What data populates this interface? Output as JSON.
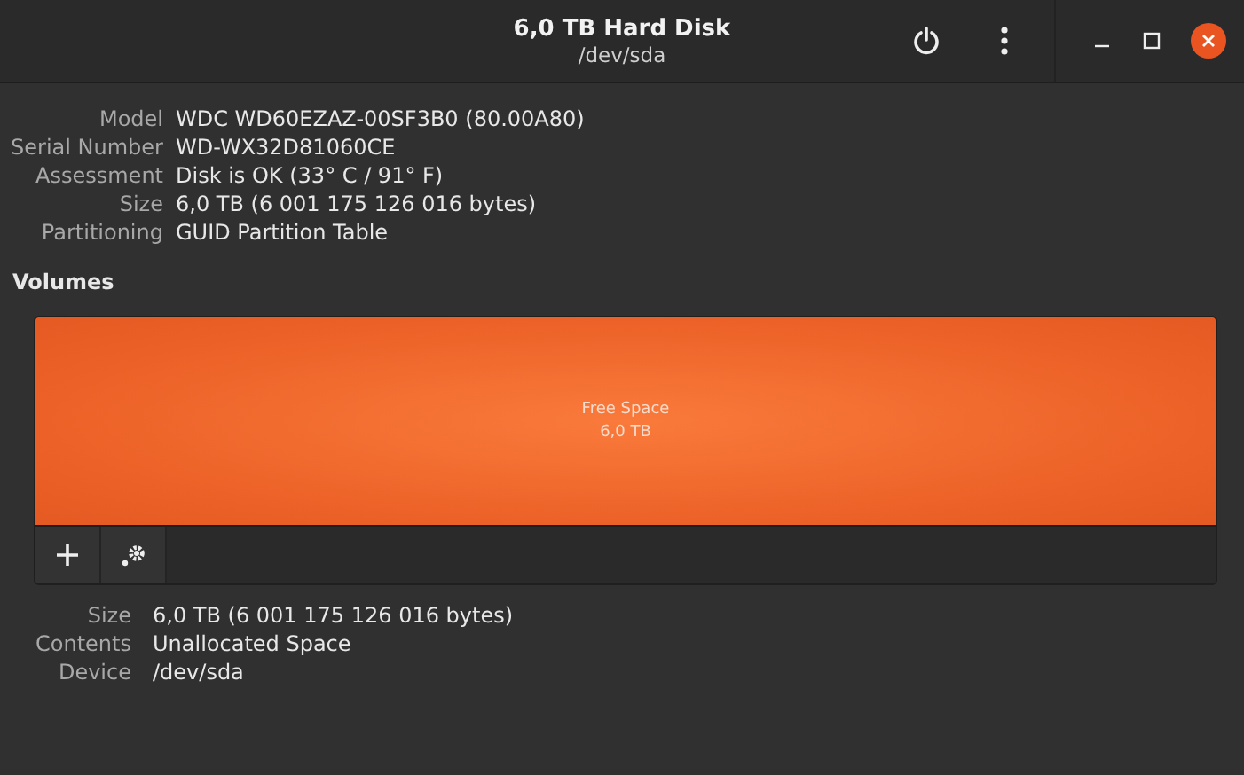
{
  "window": {
    "title": "6,0 TB Hard Disk",
    "subtitle": "/dev/sda"
  },
  "drive_properties": [
    {
      "label": "Model",
      "value": "WDC WD60EZAZ-00SF3B0 (80.00A80)"
    },
    {
      "label": "Serial Number",
      "value": "WD-WX32D81060CE"
    },
    {
      "label": "Assessment",
      "value": "Disk is OK (33° C / 91° F)"
    },
    {
      "label": "Size",
      "value": "6,0 TB (6 001 175 126 016 bytes)"
    },
    {
      "label": "Partitioning",
      "value": "GUID Partition Table"
    }
  ],
  "volumes": {
    "heading": "Volumes",
    "segments": [
      {
        "name": "Free Space",
        "size": "6,0 TB"
      }
    ]
  },
  "volume_properties": [
    {
      "label": "Size",
      "value": "6,0 TB (6 001 175 126 016 bytes)"
    },
    {
      "label": "Contents",
      "value": "Unallocated Space"
    },
    {
      "label": "Device",
      "value": "/dev/sda"
    }
  ]
}
